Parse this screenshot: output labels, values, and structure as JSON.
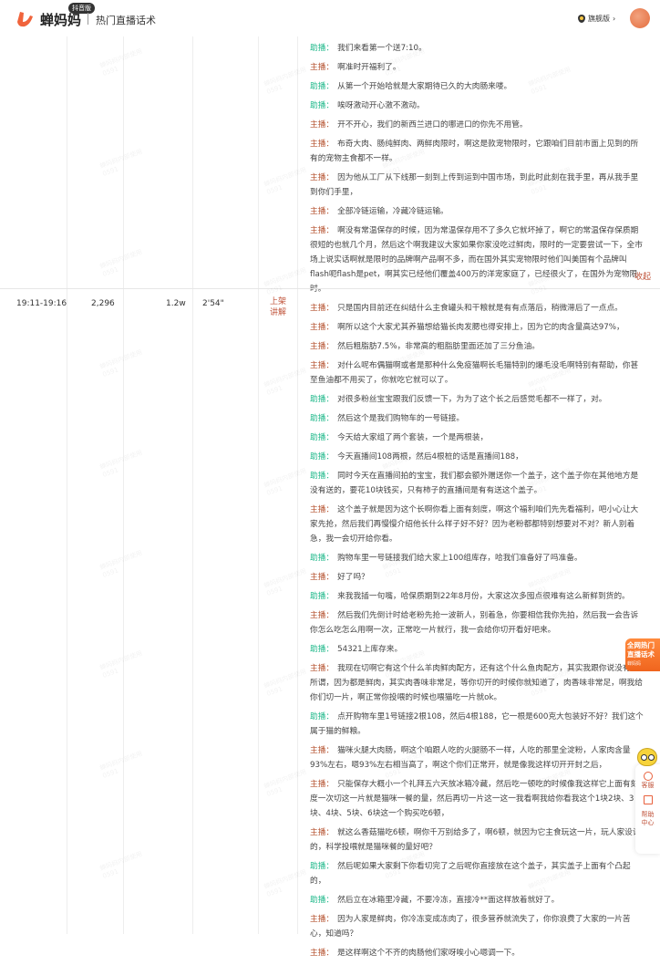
{
  "header": {
    "brand": "蝉妈妈",
    "edition_badge": "抖音版",
    "page_title": "热门直播话术",
    "vip_label": "旗舰版",
    "vip_chevron": "›"
  },
  "colors": {
    "host": "#b5522f",
    "assistant": "#21b98b",
    "accent": "#f0651e"
  },
  "rows": [
    {
      "script": [
        {
          "role": "助播：",
          "type": "assist",
          "text": "我们来看第一个送7:10。"
        },
        {
          "role": "主播：",
          "type": "host",
          "text": "啊准时开福利了。"
        },
        {
          "role": "助播：",
          "type": "assist",
          "text": "从第一个开始哈就是大家期待已久的大肉肠来喽。"
        },
        {
          "role": "助播：",
          "type": "assist",
          "text": "唉呀激动开心激不激动。"
        },
        {
          "role": "主播：",
          "type": "host",
          "text": "开不开心，我们的新西兰进口的哪进口的你先不用管。"
        },
        {
          "role": "主播：",
          "type": "host",
          "text": "布奇大肉、肠纯鲜肉、两鲜肉限时，啊这是款宠物限时，它跟咱们目前市面上见到的所有的宠物主食都不一样。"
        },
        {
          "role": "主播：",
          "type": "host",
          "text": "因为他从工厂从下线那一刻到上传到运到中国市场，到此时此刻在我手里，再从我手里到你们手里，"
        },
        {
          "role": "主播：",
          "type": "host",
          "text": "全部冷链运输，冷藏冷链运输。"
        },
        {
          "role": "主播：",
          "type": "host",
          "text": "啊没有常温保存的时候，因为常温保存用不了多久它就坏掉了，啊它的常温保存保质期很短的也就几个月，然后这个啊我建议大家如果你家没吃过鲜肉，限时的一定要尝试一下，全市场上说实话啊就是限时的品牌啊产品啊不多，而在国外其实宠物限时他们叫美国有个品牌叫flash呃flash是pet，啊其实已经他们覆盖400万的洋宠家庭了，已经很火了，在国外为宠物限时。"
        }
      ],
      "collapse_label": "收起"
    },
    {
      "time_range": "19:11-19:16",
      "viewers": "2,296",
      "sales": "1.2w",
      "duration": "2'54\"",
      "action": "上架讲解",
      "script": [
        {
          "role": "主播：",
          "type": "host",
          "text": "只是国内目前还在纠结什么主食罐头和干粮就是有有点落后，稍微滞后了一点点。"
        },
        {
          "role": "主播：",
          "type": "host",
          "text": "啊所以这个大家尤其养猫想给猫长肉发腮也得安排上，因为它的肉含量高达97%，"
        },
        {
          "role": "主播：",
          "type": "host",
          "text": "然后粗脂肪7.5%，非常高的粗脂肪里面还加了三分鱼油。"
        },
        {
          "role": "主播：",
          "type": "host",
          "text": "对什么呢布偶猫啊或者是那种什么免疫猫啊长毛猫特别的爆毛没毛啊特别有帮助，你甚至鱼油都不用买了，你就吃它就可以了。"
        },
        {
          "role": "助播：",
          "type": "assist",
          "text": "对很多粉丝宝宝跟我们反馈一下，为为了这个长之后感觉毛都不一样了，对。"
        },
        {
          "role": "助播：",
          "type": "assist",
          "text": "然后这个是我们购物车的一号链接。"
        },
        {
          "role": "助播：",
          "type": "assist",
          "text": "今天给大家组了两个套装，一个是两根装，"
        },
        {
          "role": "助播：",
          "type": "assist",
          "text": "今天直播间108两根，然后4根桩的话是直播间188，"
        },
        {
          "role": "助播：",
          "type": "assist",
          "text": "同时今天在直播间拍的宝宝，我们都会额外赠送你一个盖子，这个盖子你在其他地方是没有送的，要花10块钱买，只有柿子的直播间是有有送这个盖子。"
        },
        {
          "role": "主播：",
          "type": "host",
          "text": "这个盖子就是因为这个长啊你看上面有刻度，啊这个福利咱们先先看福利，吧小心让大家先抢，然后我们再慢慢介绍他长什么样子好不好？因为老粉都都特别想要对不对？新人别着急，我一会切开给你看。"
        },
        {
          "role": "助播：",
          "type": "assist",
          "text": "购物车里一号链接我们给大家上100组库存，哈我们准备好了吗准备。"
        },
        {
          "role": "主播：",
          "type": "host",
          "text": "好了吗？"
        },
        {
          "role": "助播：",
          "type": "assist",
          "text": "来我我插一句嘴，哈保质期到22年8月份，大家这次多囤点很难有这么新鲜到货的。"
        },
        {
          "role": "主播：",
          "type": "host",
          "text": "然后我们先倒计时给老粉先抢一波新人，别着急，你要相信我你先拍，然后我一会告诉你怎么吃怎么用啊一次，正常吃一片就行，我一会给你切开看好吧来。"
        },
        {
          "role": "助播：",
          "type": "assist",
          "text": "54321上库存来。"
        },
        {
          "role": "主播：",
          "type": "host",
          "text": "我现在切啊它有这个什么羊肉鲜肉配方，还有这个什么鱼肉配方，其实我跟你说没有无所谓，因为都是鲜肉，其实肉香味非常足，等你切开的时候你就知道了，肉香味非常足，啊我给你们切一片，啊正常你投喂的时候也喂猫吃一片就ok。"
        },
        {
          "role": "助播：",
          "type": "assist",
          "text": "点开购物车里1号链接2根108，然后4根188，它一根是600克大包装好不好？我们这个属于猫的鲜粮。"
        },
        {
          "role": "主播：",
          "type": "host",
          "text": "猫咪火腿大肉肠，啊这个咱跟人吃的火腿肠不一样，人吃的那里全淀粉，人家肉含量93%左右，嗯93%左右相当高了，啊这个你们正常开，就是像我这样切开开封之后，"
        },
        {
          "role": "主播：",
          "type": "host",
          "text": "只能保存大概小一个礼拜五六天放冰箱冷藏，然后吃一顿吃的时候像我这样它上面有刻度一次切这一片就是猫咪一餐的量，然后再切一片这一这一我看啊我给你看我这个1块2块、3块、4块、5块、6块这一个购买吃6顿，"
        },
        {
          "role": "主播：",
          "type": "host",
          "text": "就这么香菇猫吃6顿，啊你千万别给多了，啊6顿，就因为它主食玩这一片，玩人家设计的，科学投喂就是猫咪餐的量好吧？"
        },
        {
          "role": "助播：",
          "type": "assist",
          "text": "然后呢如果大家剩下你看切完了之后呢你直接放在这个盖子，其实盖子上面有个凸起的，"
        },
        {
          "role": "助播：",
          "type": "assist",
          "text": "然后立在冰箱里冷藏，不要冷冻，直接冷**面这样放着就好了。"
        },
        {
          "role": "主播：",
          "type": "host",
          "text": "因为人家是鲜肉，你冷冻变成冻肉了，很多营养就流失了，你你浪费了大家的一片苦心，知道吗？"
        },
        {
          "role": "主播：",
          "type": "host",
          "text": "是这样啊这个不齐的肉肠他们家呀唉小心嗯调一下。"
        }
      ]
    }
  ],
  "float_badge": {
    "line1": "全网热门",
    "line2": "直播话术",
    "sub": "蝉妈妈"
  },
  "help_panel": {
    "service": "客服",
    "help": "帮助中心"
  },
  "watermark": {
    "text": "蝉妈妈内部使用",
    "code": "0591"
  }
}
